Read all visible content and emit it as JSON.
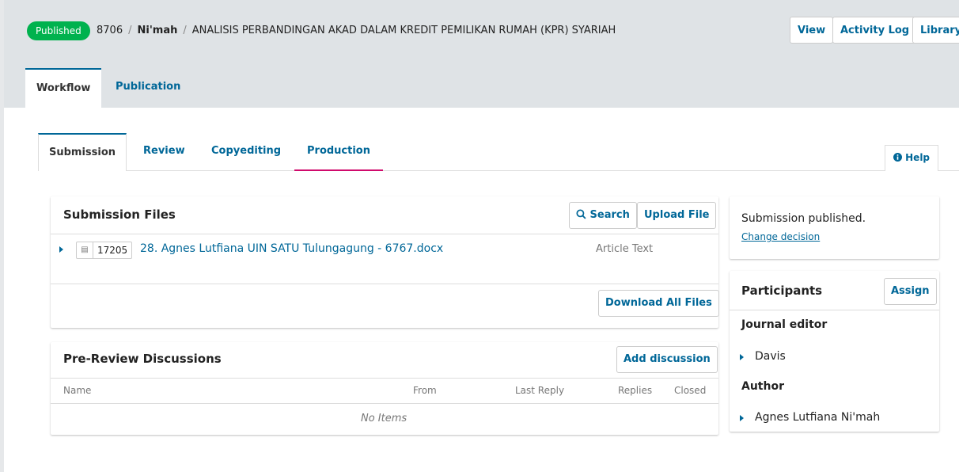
{
  "header": {
    "status_badge": "Published",
    "submission_id": "8706",
    "separator": "/",
    "author": "Ni'mah",
    "title": "ANALISIS PERBANDINGAN AKAD DALAM KREDIT PEMILIKAN RUMAH (KPR) SYARIAH",
    "buttons": {
      "view": "View",
      "activity_log": "Activity Log",
      "library": "Library"
    }
  },
  "primary_tabs": {
    "workflow": "Workflow",
    "publication": "Publication"
  },
  "stage_tabs": {
    "submission": "Submission",
    "review": "Review",
    "copyediting": "Copyediting",
    "production": "Production"
  },
  "help": {
    "icon": "info-circle-icon",
    "label": "Help"
  },
  "submission_files": {
    "title": "Submission Files",
    "search_label": "Search",
    "upload_label": "Upload File",
    "file": {
      "id": "17205",
      "name": "28. Agnes Lutfiana UIN SATU Tulungagung - 6767.docx",
      "type": "Article Text"
    },
    "download_all_label": "Download All Files"
  },
  "discussions": {
    "title": "Pre-Review Discussions",
    "add_label": "Add discussion",
    "columns": {
      "name": "Name",
      "from": "From",
      "last_reply": "Last Reply",
      "replies": "Replies",
      "closed": "Closed"
    },
    "empty": "No Items"
  },
  "decision": {
    "status": "Submission published.",
    "change_link": "Change decision"
  },
  "participants": {
    "title": "Participants",
    "assign_label": "Assign",
    "groups": [
      {
        "role": "Journal editor",
        "members": [
          "Davis"
        ]
      },
      {
        "role": "Author",
        "members": [
          "Agnes Lutfiana Ni'mah"
        ]
      }
    ]
  },
  "colors": {
    "accent": "#006798",
    "published": "#00b24e",
    "production_underline": "#d00a6c"
  }
}
